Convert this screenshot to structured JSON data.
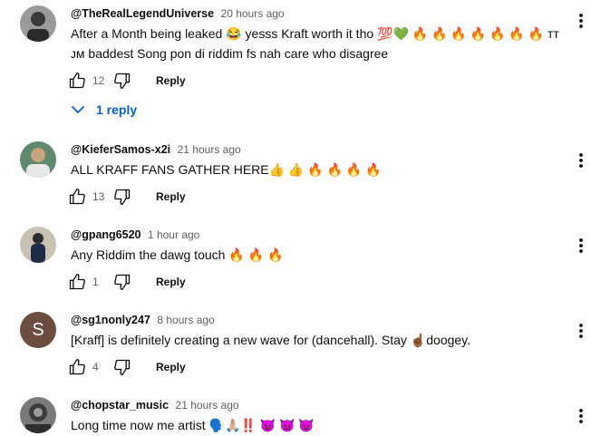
{
  "comments": [
    {
      "author": "@TheRealLegendUniverse",
      "time": "20 hours ago",
      "text": "After a Month being leaked 😂 yesss Kraft worth it tho 💯💚 🔥 🔥 🔥 🔥 🔥 🔥 🔥 ᴛᴛ ᴊᴍ baddest Song pon di riddim fs nah care who disagree",
      "likes": "12",
      "reply_label": "Reply",
      "avatar_icon": "user-photo-icon",
      "replies_label": "1 reply"
    },
    {
      "author": "@KieferSamos-x2i",
      "time": "21 hours ago",
      "text": "ALL KRAFF FANS GATHER HERE👍 👍 🔥 🔥 🔥 🔥",
      "likes": "13",
      "reply_label": "Reply",
      "avatar_icon": "user-photo-icon"
    },
    {
      "author": "@gpang6520",
      "time": "1 hour ago",
      "text": "Any Riddim the dawg touch 🔥 🔥 🔥",
      "likes": "1",
      "reply_label": "Reply",
      "avatar_icon": "user-photo-icon"
    },
    {
      "author": "@sg1nonly247",
      "time": "8 hours ago",
      "text": "[Kraff] is definitely creating a new wave for (dancehall). Stay ☝🏾doogey.",
      "likes": "4",
      "reply_label": "Reply",
      "avatar_letter": "S",
      "avatar_color": "#6d4c41"
    },
    {
      "author": "@chopstar_music",
      "time": "21 hours ago",
      "text": "Long time now me artist 🗣️🙏🏼‼️ 😈 😈 😈",
      "avatar_icon": "user-photo-icon"
    }
  ],
  "icons": {
    "like": "thumbs-up-icon",
    "dislike": "thumbs-down-icon",
    "menu": "more-vertical-icon",
    "expand": "chevron-down-icon"
  },
  "colors": {
    "link": "#065fd4",
    "secondary_text": "#606060"
  }
}
